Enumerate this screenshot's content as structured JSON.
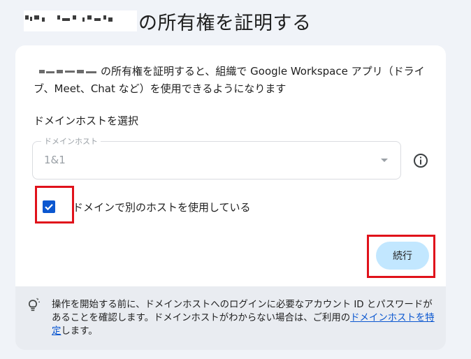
{
  "header": {
    "title": "の所有権を証明する"
  },
  "intro": {
    "text": "の所有権を証明すると、組織で Google Workspace アプリ（ドライブ、Meet、Chat など）を使用できるようになります"
  },
  "host_section": {
    "label": "ドメインホストを選択",
    "select": {
      "legend": "ドメインホスト",
      "value": "1&1"
    },
    "info_icon": "info-icon"
  },
  "checkbox": {
    "label": "ドメインで別のホストを使用している",
    "checked": true
  },
  "actions": {
    "continue_label": "続行"
  },
  "notice": {
    "text_before": "操作を開始する前に、ドメインホストへのログインに必要なアカウント ID とパスワードがあることを確認します。ドメインホストがわからない場合は、ご利用の",
    "link_text": "ドメインホストを特定",
    "text_after": "します。",
    "icon": "lightbulb-icon"
  },
  "colors": {
    "page_background": "#f0f3f8",
    "card_background": "#ffffff",
    "notice_background": "#e9ecf1",
    "accent": "#0b57d0",
    "button_fill": "#c2e7ff",
    "highlight_outline": "#e0121b"
  }
}
